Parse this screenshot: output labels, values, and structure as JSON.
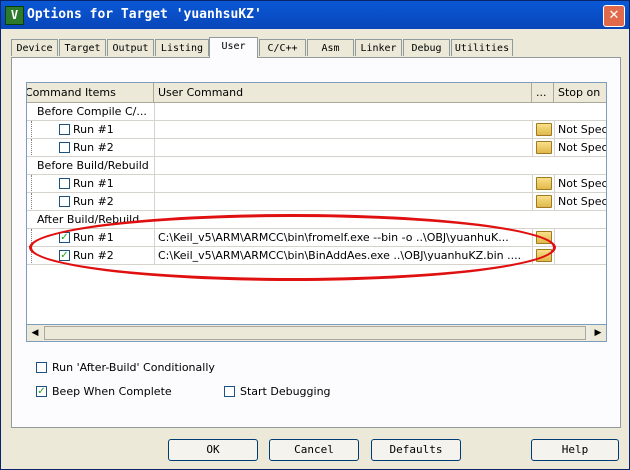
{
  "window": {
    "title": "Options for Target 'yuanhsuKZ'",
    "icon_glyph": "V",
    "close_glyph": "✕"
  },
  "tabs": [
    {
      "label": "Device"
    },
    {
      "label": "Target"
    },
    {
      "label": "Output"
    },
    {
      "label": "Listing"
    },
    {
      "label": "User",
      "active": true
    },
    {
      "label": "C/C++"
    },
    {
      "label": "Asm"
    },
    {
      "label": "Linker"
    },
    {
      "label": "Debug"
    },
    {
      "label": "Utilities"
    }
  ],
  "grid": {
    "headers": {
      "items": "Command Items",
      "command": "User Command",
      "browse": "...",
      "stop": "Stop on"
    },
    "groups": [
      {
        "label": "Before Compile C/...",
        "runs": [
          {
            "label": "Run #1",
            "checked": false,
            "command": "",
            "stop": "Not Spec"
          },
          {
            "label": "Run #2",
            "checked": false,
            "command": "",
            "stop": "Not Spec"
          }
        ]
      },
      {
        "label": "Before Build/Rebuild",
        "runs": [
          {
            "label": "Run #1",
            "checked": false,
            "command": "",
            "stop": "Not Spec"
          },
          {
            "label": "Run #2",
            "checked": false,
            "command": "",
            "stop": "Not Spec"
          }
        ]
      },
      {
        "label": "After Build/Rebuild",
        "runs": [
          {
            "label": "Run #1",
            "checked": true,
            "command": "C:\\Keil_v5\\ARM\\ARMCC\\bin\\fromelf.exe   --bin -o  ..\\OBJ\\yuanhuK...",
            "stop": ""
          },
          {
            "label": "Run #2",
            "checked": true,
            "command": "C:\\Keil_v5\\ARM\\ARMCC\\bin\\BinAddAes.exe ..\\OBJ\\yuanhuKZ.bin ....",
            "stop": ""
          }
        ]
      }
    ]
  },
  "options": {
    "run_after_build": {
      "label": "Run 'After-Build' Conditionally",
      "checked": false
    },
    "beep": {
      "label": "Beep When Complete",
      "checked": true
    },
    "start_debugging": {
      "label": "Start Debugging",
      "checked": false
    }
  },
  "buttons": {
    "ok": "OK",
    "cancel": "Cancel",
    "defaults": "Defaults",
    "help": "Help"
  },
  "glyphs": {
    "check": "✓",
    "scroll_left": "◀",
    "scroll_right": "▶"
  },
  "colors": {
    "titlebar": "#0a58d6",
    "annotation": "#e01010"
  }
}
